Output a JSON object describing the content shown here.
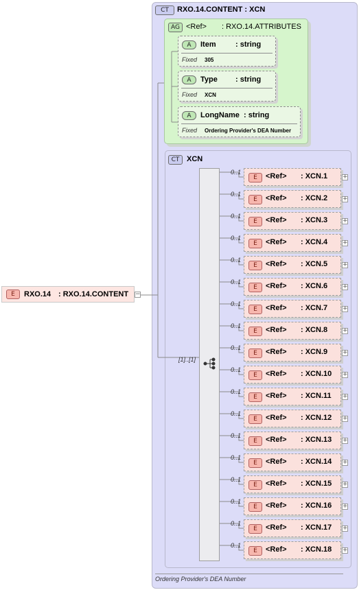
{
  "root": {
    "badge": "E",
    "name": "RXO.14",
    "type": ": RXO.14.CONTENT",
    "toggle": "−"
  },
  "content_type": {
    "badge": "CT",
    "title": "RXO.14.CONTENT : XCN",
    "documentation": "Ordering Provider's DEA Number"
  },
  "attribute_group": {
    "badge": "AG",
    "ref": "<Ref>",
    "type": ": RXO.14.ATTRIBUTES",
    "attributes": [
      {
        "badge": "A",
        "name": "Item",
        "type": ": string",
        "fixed_label": "Fixed",
        "fixed_value": "305"
      },
      {
        "badge": "A",
        "name": "Type",
        "type": ": string",
        "fixed_label": "Fixed",
        "fixed_value": "XCN"
      },
      {
        "badge": "A",
        "name": "LongName",
        "type": ": string",
        "fixed_label": "Fixed",
        "fixed_value": "Ordering Provider's DEA Number"
      }
    ]
  },
  "inner_type": {
    "badge": "CT",
    "title": "XCN"
  },
  "sequence": {
    "occurrence": "[1]..[1]"
  },
  "elements": [
    {
      "occurs": "0..1",
      "badge": "E",
      "ref": "<Ref>",
      "type": ": XCN.1",
      "toggle": "+"
    },
    {
      "occurs": "0..1",
      "badge": "E",
      "ref": "<Ref>",
      "type": ": XCN.2",
      "toggle": "+"
    },
    {
      "occurs": "0..1",
      "badge": "E",
      "ref": "<Ref>",
      "type": ": XCN.3",
      "toggle": "+"
    },
    {
      "occurs": "0..1",
      "badge": "E",
      "ref": "<Ref>",
      "type": ": XCN.4",
      "toggle": "+"
    },
    {
      "occurs": "0..1",
      "badge": "E",
      "ref": "<Ref>",
      "type": ": XCN.5",
      "toggle": "+"
    },
    {
      "occurs": "0..1",
      "badge": "E",
      "ref": "<Ref>",
      "type": ": XCN.6",
      "toggle": "+"
    },
    {
      "occurs": "0..1",
      "badge": "E",
      "ref": "<Ref>",
      "type": ": XCN.7",
      "toggle": "+"
    },
    {
      "occurs": "0..1",
      "badge": "E",
      "ref": "<Ref>",
      "type": ": XCN.8",
      "toggle": "+"
    },
    {
      "occurs": "0..1",
      "badge": "E",
      "ref": "<Ref>",
      "type": ": XCN.9",
      "toggle": "+"
    },
    {
      "occurs": "0..1",
      "badge": "E",
      "ref": "<Ref>",
      "type": ": XCN.10",
      "toggle": "+"
    },
    {
      "occurs": "0..1",
      "badge": "E",
      "ref": "<Ref>",
      "type": ": XCN.11",
      "toggle": "+"
    },
    {
      "occurs": "0..1",
      "badge": "E",
      "ref": "<Ref>",
      "type": ": XCN.12",
      "toggle": "+"
    },
    {
      "occurs": "0..1",
      "badge": "E",
      "ref": "<Ref>",
      "type": ": XCN.13",
      "toggle": "+"
    },
    {
      "occurs": "0..1",
      "badge": "E",
      "ref": "<Ref>",
      "type": ": XCN.14",
      "toggle": "+"
    },
    {
      "occurs": "0..1",
      "badge": "E",
      "ref": "<Ref>",
      "type": ": XCN.15",
      "toggle": "+"
    },
    {
      "occurs": "0..1",
      "badge": "E",
      "ref": "<Ref>",
      "type": ": XCN.16",
      "toggle": "+"
    },
    {
      "occurs": "0..1",
      "badge": "E",
      "ref": "<Ref>",
      "type": ": XCN.17",
      "toggle": "+"
    },
    {
      "occurs": "0..1",
      "badge": "E",
      "ref": "<Ref>",
      "type": ": XCN.18",
      "toggle": "+"
    }
  ]
}
